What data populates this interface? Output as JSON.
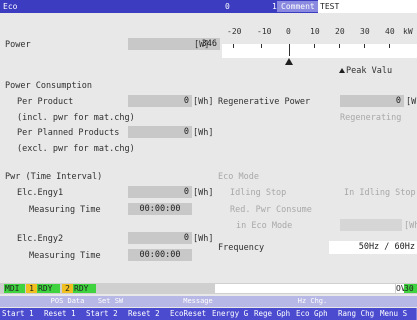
{
  "title_bar": {
    "screen_name": "Eco",
    "path_left": "0",
    "path_right": "1",
    "comment_label": "Comment",
    "comment_value": "TEST"
  },
  "power": {
    "label": "Power",
    "value": "346",
    "unit": "[W]",
    "scale_ticks": [
      "-20",
      "-10",
      "0",
      "10",
      "20",
      "30",
      "40"
    ],
    "scale_unit": "kW",
    "current_kw": 0,
    "peak_label": "Peak Valu"
  },
  "power_consumption": {
    "section_label": "Power Consumption",
    "per_product_label": "Per Product",
    "per_product_value": "0",
    "per_product_unit": "[Wh]",
    "per_product_note": "(incl. pwr for mat.chg)",
    "per_planned_label": "Per Planned Products",
    "per_planned_value": "0",
    "per_planned_unit": "[Wh]",
    "per_planned_note": "(excl. pwr for mat.chg)"
  },
  "regenerative": {
    "label": "Regenerative Power",
    "value": "0",
    "unit": "[W",
    "status": "Regenerating"
  },
  "time_interval": {
    "section_label": "Pwr (Time Interval)",
    "engy1_label": "Elc.Engy1",
    "engy1_value": "0",
    "engy1_unit": "[Wh]",
    "meas1_label": "Measuring Time",
    "meas1_value": "00:00:00",
    "engy2_label": "Elc.Engy2",
    "engy2_value": "0",
    "engy2_unit": "[Wh]",
    "meas2_label": "Measuring Time",
    "meas2_value": "00:00:00"
  },
  "eco_mode": {
    "section_label": "Eco Mode",
    "idling_stop_label": "Idling Stop",
    "idling_stop_status": "In Idling Stop",
    "red_pwr_label": "Red. Pwr Consume",
    "in_eco_label": "in Eco Mode",
    "in_eco_unit": "[Wh"
  },
  "frequency": {
    "label": "Frequency",
    "value": "50Hz / 60Hz"
  },
  "status_bar": {
    "mode": "MDI",
    "sys1_num": "1",
    "sys1": "RDY",
    "sys2_num": "2",
    "sys2": "RDY",
    "ovr_label": "OVR",
    "ovr_value": "30"
  },
  "hints": [
    "POS Data",
    "Set SW",
    "Message",
    "Hz Chg."
  ],
  "softkeys": [
    "Start 1",
    "Reset 1",
    "Start 2",
    "Reset 2",
    "EcoReset",
    "Energy G",
    "Rege Gph",
    "Eco Gph",
    "Rang Chg",
    "Menu S"
  ],
  "colors": {
    "title_bar": "#3c3cc0",
    "background": "#e8e8e8",
    "value_box": "#c8c8c8",
    "status_green": "#3fd43f",
    "status_yellow": "#f0c020",
    "softkey_blue": "#4b4bd0"
  }
}
